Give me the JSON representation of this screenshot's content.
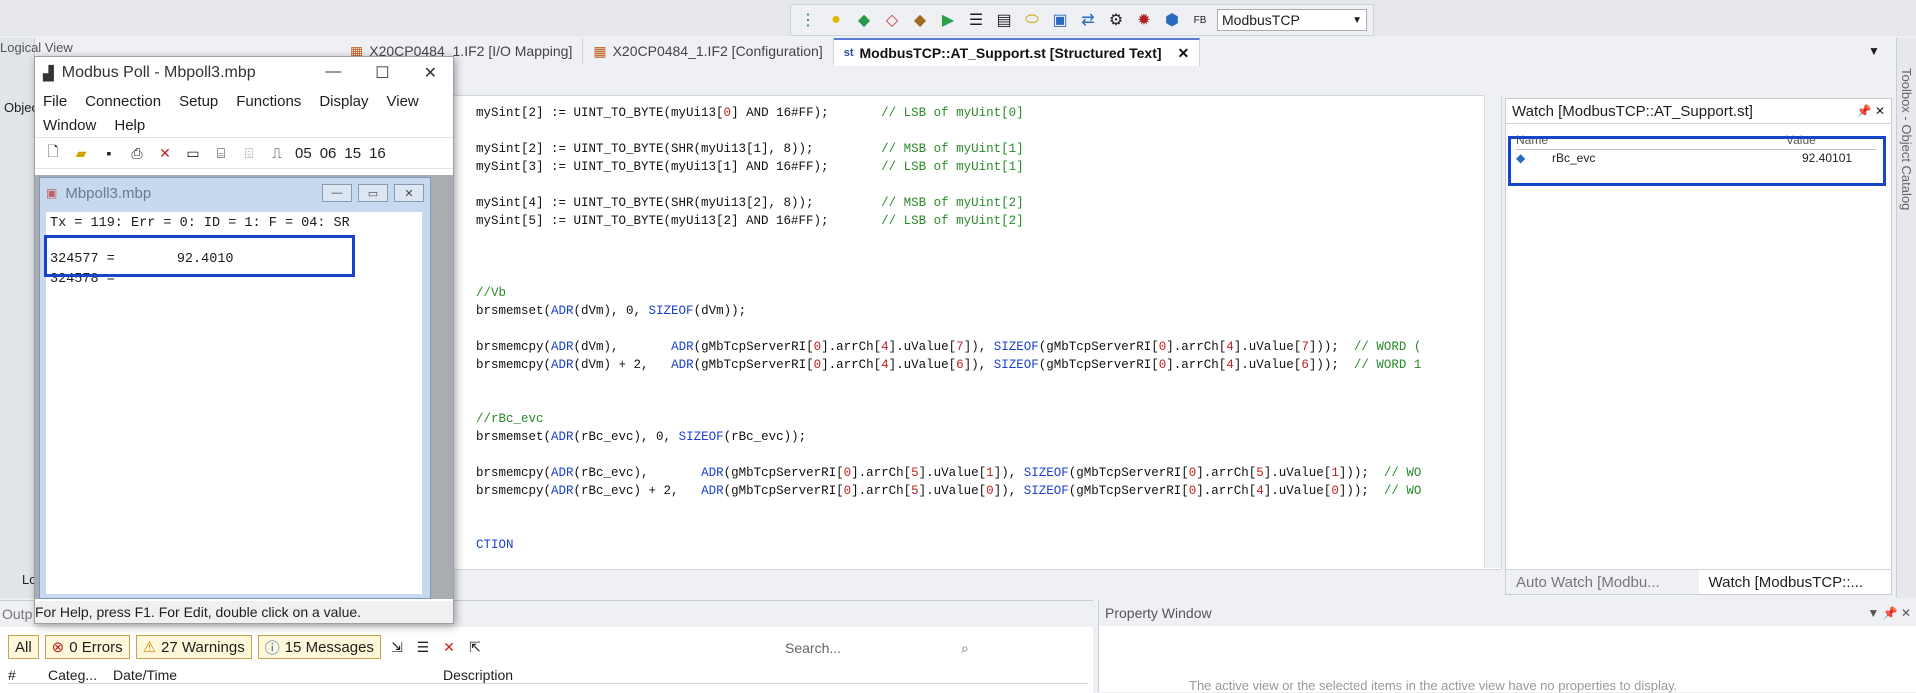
{
  "top_toolbar": {
    "target_value": "ModbusTCP"
  },
  "tabs": [
    {
      "label": "X20CP0484_1.IF2 [I/O Mapping]"
    },
    {
      "label": "X20CP0484_1.IF2 [Configuration]"
    },
    {
      "label": "ModbusTCP::AT_Support.st [Structured Text]"
    }
  ],
  "logical_view": {
    "title": "Logical View",
    "tab": "Objec",
    "bottom_tab": "Logi"
  },
  "editor": {
    "lines": [
      [
        {
          "t": "mySint[2] := UINT_TO_BYTE(myUi13[",
          "c": ""
        },
        {
          "t": "0",
          "c": "nm"
        },
        {
          "t": "] AND 16#FF);       ",
          "c": ""
        },
        {
          "t": "// LSB of myUint[0]",
          "c": "cm"
        }
      ],
      [
        {
          "t": "",
          "c": ""
        }
      ],
      [
        {
          "t": "mySint[2] := UINT_TO_BYTE(SHR(myUi13[1], 8));         ",
          "c": ""
        },
        {
          "t": "// MSB of myUint[1]",
          "c": "cm"
        }
      ],
      [
        {
          "t": "mySint[3] := UINT_TO_BYTE(myUi13[1] AND 16#FF);       ",
          "c": ""
        },
        {
          "t": "// LSB of myUint[1]",
          "c": "cm"
        }
      ],
      [
        {
          "t": "",
          "c": ""
        }
      ],
      [
        {
          "t": "mySint[4] := UINT_TO_BYTE(SHR(myUi13[2], 8));         ",
          "c": ""
        },
        {
          "t": "// MSB of myUint[2]",
          "c": "cm"
        }
      ],
      [
        {
          "t": "mySint[5] := UINT_TO_BYTE(myUi13[2] AND 16#FF);       ",
          "c": ""
        },
        {
          "t": "// LSB of myUint[2]",
          "c": "cm"
        }
      ],
      [
        {
          "t": "",
          "c": ""
        }
      ],
      [
        {
          "t": "",
          "c": ""
        }
      ],
      [
        {
          "t": "",
          "c": ""
        }
      ],
      [
        {
          "t": "//Vb",
          "c": "cm"
        }
      ],
      [
        {
          "t": "brsmemset(",
          "c": ""
        },
        {
          "t": "ADR",
          "c": "kw"
        },
        {
          "t": "(dVm), 0, ",
          "c": ""
        },
        {
          "t": "SIZEOF",
          "c": "kw"
        },
        {
          "t": "(dVm));",
          "c": ""
        }
      ],
      [
        {
          "t": "",
          "c": ""
        }
      ],
      [
        {
          "t": "brsmemcpy(",
          "c": ""
        },
        {
          "t": "ADR",
          "c": "kw"
        },
        {
          "t": "(dVm),       ",
          "c": ""
        },
        {
          "t": "ADR",
          "c": "kw"
        },
        {
          "t": "(gMbTcpServerRI[",
          "c": ""
        },
        {
          "t": "0",
          "c": "nm"
        },
        {
          "t": "].arrCh[",
          "c": ""
        },
        {
          "t": "4",
          "c": "nm"
        },
        {
          "t": "].uValue[",
          "c": ""
        },
        {
          "t": "7",
          "c": "nm"
        },
        {
          "t": "]), ",
          "c": ""
        },
        {
          "t": "SIZEOF",
          "c": "kw"
        },
        {
          "t": "(gMbTcpServerRI[",
          "c": ""
        },
        {
          "t": "0",
          "c": "nm"
        },
        {
          "t": "].arrCh[",
          "c": ""
        },
        {
          "t": "4",
          "c": "nm"
        },
        {
          "t": "].uValue[",
          "c": ""
        },
        {
          "t": "7",
          "c": "nm"
        },
        {
          "t": "]));  ",
          "c": ""
        },
        {
          "t": "// WORD (",
          "c": "cm"
        }
      ],
      [
        {
          "t": "brsmemcpy(",
          "c": ""
        },
        {
          "t": "ADR",
          "c": "kw"
        },
        {
          "t": "(dVm) + 2,   ",
          "c": ""
        },
        {
          "t": "ADR",
          "c": "kw"
        },
        {
          "t": "(gMbTcpServerRI[",
          "c": ""
        },
        {
          "t": "0",
          "c": "nm"
        },
        {
          "t": "].arrCh[",
          "c": ""
        },
        {
          "t": "4",
          "c": "nm"
        },
        {
          "t": "].uValue[",
          "c": ""
        },
        {
          "t": "6",
          "c": "nm"
        },
        {
          "t": "]), ",
          "c": ""
        },
        {
          "t": "SIZEOF",
          "c": "kw"
        },
        {
          "t": "(gMbTcpServerRI[",
          "c": ""
        },
        {
          "t": "0",
          "c": "nm"
        },
        {
          "t": "].arrCh[",
          "c": ""
        },
        {
          "t": "4",
          "c": "nm"
        },
        {
          "t": "].uValue[",
          "c": ""
        },
        {
          "t": "6",
          "c": "nm"
        },
        {
          "t": "]));  ",
          "c": ""
        },
        {
          "t": "// WORD 1",
          "c": "cm"
        }
      ],
      [
        {
          "t": "",
          "c": ""
        }
      ],
      [
        {
          "t": "",
          "c": ""
        }
      ],
      [
        {
          "t": "//rBc_evc",
          "c": "cm"
        }
      ],
      [
        {
          "t": "brsmemset(",
          "c": ""
        },
        {
          "t": "ADR",
          "c": "kw"
        },
        {
          "t": "(rBc_evc), 0, ",
          "c": ""
        },
        {
          "t": "SIZEOF",
          "c": "kw"
        },
        {
          "t": "(rBc_evc));",
          "c": ""
        }
      ],
      [
        {
          "t": "",
          "c": ""
        }
      ],
      [
        {
          "t": "brsmemcpy(",
          "c": ""
        },
        {
          "t": "ADR",
          "c": "kw"
        },
        {
          "t": "(rBc_evc),       ",
          "c": ""
        },
        {
          "t": "ADR",
          "c": "kw"
        },
        {
          "t": "(gMbTcpServerRI[",
          "c": ""
        },
        {
          "t": "0",
          "c": "nm"
        },
        {
          "t": "].arrCh[",
          "c": ""
        },
        {
          "t": "5",
          "c": "nm"
        },
        {
          "t": "].uValue[",
          "c": ""
        },
        {
          "t": "1",
          "c": "nm"
        },
        {
          "t": "]), ",
          "c": ""
        },
        {
          "t": "SIZEOF",
          "c": "kw"
        },
        {
          "t": "(gMbTcpServerRI[",
          "c": ""
        },
        {
          "t": "0",
          "c": "nm"
        },
        {
          "t": "].arrCh[",
          "c": ""
        },
        {
          "t": "5",
          "c": "nm"
        },
        {
          "t": "].uValue[",
          "c": ""
        },
        {
          "t": "1",
          "c": "nm"
        },
        {
          "t": "]));  ",
          "c": ""
        },
        {
          "t": "// WO",
          "c": "cm"
        }
      ],
      [
        {
          "t": "brsmemcpy(",
          "c": ""
        },
        {
          "t": "ADR",
          "c": "kw"
        },
        {
          "t": "(rBc_evc) + 2,   ",
          "c": ""
        },
        {
          "t": "ADR",
          "c": "kw"
        },
        {
          "t": "(gMbTcpServerRI[",
          "c": ""
        },
        {
          "t": "0",
          "c": "nm"
        },
        {
          "t": "].arrCh[",
          "c": ""
        },
        {
          "t": "5",
          "c": "nm"
        },
        {
          "t": "].uValue[",
          "c": ""
        },
        {
          "t": "0",
          "c": "nm"
        },
        {
          "t": "]), ",
          "c": ""
        },
        {
          "t": "SIZEOF",
          "c": "kw"
        },
        {
          "t": "(gMbTcpServerRI[",
          "c": ""
        },
        {
          "t": "0",
          "c": "nm"
        },
        {
          "t": "].arrCh[",
          "c": ""
        },
        {
          "t": "4",
          "c": "nm"
        },
        {
          "t": "].uValue[",
          "c": ""
        },
        {
          "t": "0",
          "c": "nm"
        },
        {
          "t": "]));  ",
          "c": ""
        },
        {
          "t": "// WO",
          "c": "cm"
        }
      ],
      [
        {
          "t": "",
          "c": ""
        }
      ],
      [
        {
          "t": "",
          "c": ""
        }
      ],
      [
        {
          "t": "CTION",
          "c": "kw"
        }
      ]
    ]
  },
  "watch": {
    "title": "Watch [ModbusTCP::AT_Support.st]",
    "col_name": "Name",
    "col_value": "Value",
    "var_name": "rBc_evc",
    "var_value": "92.40101",
    "tab_auto": "Auto Watch [Modbu...",
    "tab_watch": "Watch [ModbusTCP::..."
  },
  "toolbox": {
    "label": "Toolbox - Object Catalog"
  },
  "output": {
    "title": "Outp",
    "all": "All",
    "errors": "0 Errors",
    "warnings": "27 Warnings",
    "messages": "15 Messages",
    "search_placeholder": "Search...",
    "col_num": "#",
    "col_cat": "Categ...",
    "col_date": "Date/Time",
    "col_desc": "Description"
  },
  "property": {
    "title": "Property Window",
    "message": "The active view or the selected items in the active view have no properties to display."
  },
  "modbus_poll": {
    "title": "Modbus Poll - Mbpoll3.mbp",
    "menu1": [
      "File",
      "Connection",
      "Setup",
      "Functions",
      "Display",
      "View"
    ],
    "menu2": [
      "Window",
      "Help"
    ],
    "tool_numbers": [
      "05",
      "06",
      "15",
      "16"
    ],
    "child_title": "Mbpoll3.mbp",
    "status_line": "Tx = 119: Err = 0: ID = 1: F = 04: SR",
    "reg1_addr": "324577 =",
    "reg1_value": "92.4010",
    "reg2_addr": "324578 =",
    "statusbar": "For Help, press F1.  For Edit, double click on a value."
  }
}
